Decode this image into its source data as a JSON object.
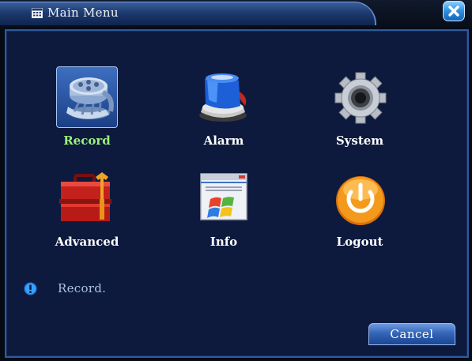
{
  "window": {
    "title": "Main Menu",
    "title_icon": "menu-grid-icon",
    "close_icon": "close-icon"
  },
  "menu": {
    "selected": "Record",
    "items": [
      {
        "label": "Record",
        "icon": "film-reel-icon"
      },
      {
        "label": "Alarm",
        "icon": "siren-icon"
      },
      {
        "label": "System",
        "icon": "gear-icon"
      },
      {
        "label": "Advanced",
        "icon": "toolbox-icon"
      },
      {
        "label": "Info",
        "icon": "window-info-icon"
      },
      {
        "label": "Logout",
        "icon": "power-icon"
      }
    ]
  },
  "status": {
    "icon": "info-icon",
    "text": "Record."
  },
  "footer": {
    "cancel_label": "Cancel"
  },
  "colors": {
    "panel_bg": "#0d1a3d",
    "accent_blue": "#2e5aa0",
    "selected_label": "#9cf07c",
    "label": "#ffffff"
  }
}
